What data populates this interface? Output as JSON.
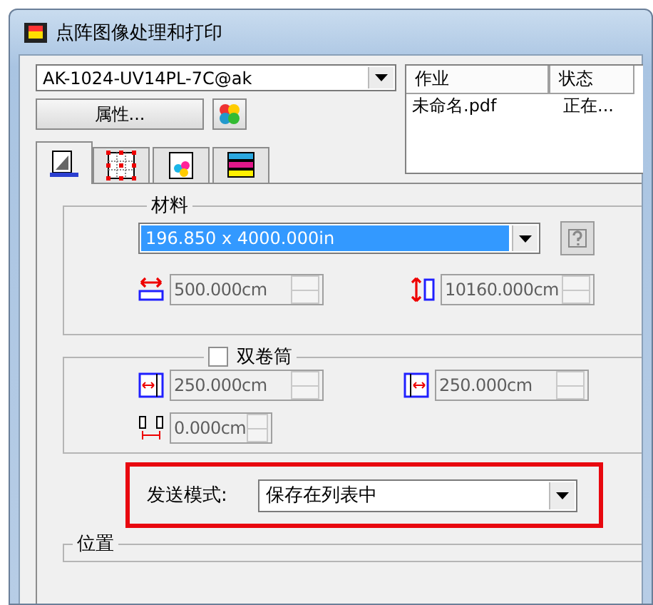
{
  "window": {
    "title": "点阵图像处理和打印"
  },
  "printer": {
    "value": "AK-1024-UV14PL-7C@ak"
  },
  "properties_button": "属性...",
  "job_list": {
    "columns": [
      "作业",
      "状态"
    ],
    "rows": [
      [
        "未命名.pdf",
        "正在..."
      ]
    ]
  },
  "tabs": [
    {
      "selected": true
    },
    {
      "selected": false
    },
    {
      "selected": false
    },
    {
      "selected": false
    }
  ],
  "material": {
    "legend": "材料",
    "media": "196.850 x 4000.000in",
    "width": {
      "value": "500.000cm",
      "disabled": true
    },
    "length": {
      "value": "10160.000cm",
      "disabled": true
    }
  },
  "dual_roll": {
    "label": "双卷筒",
    "checked": false,
    "left": {
      "value": "250.000cm",
      "disabled": true
    },
    "right": {
      "value": "250.000cm",
      "disabled": true
    },
    "gap": {
      "value": "0.000cm",
      "disabled": true
    }
  },
  "send_mode": {
    "label": "发送模式:",
    "value": "保存在列表中"
  },
  "position": {
    "legend": "位置"
  }
}
